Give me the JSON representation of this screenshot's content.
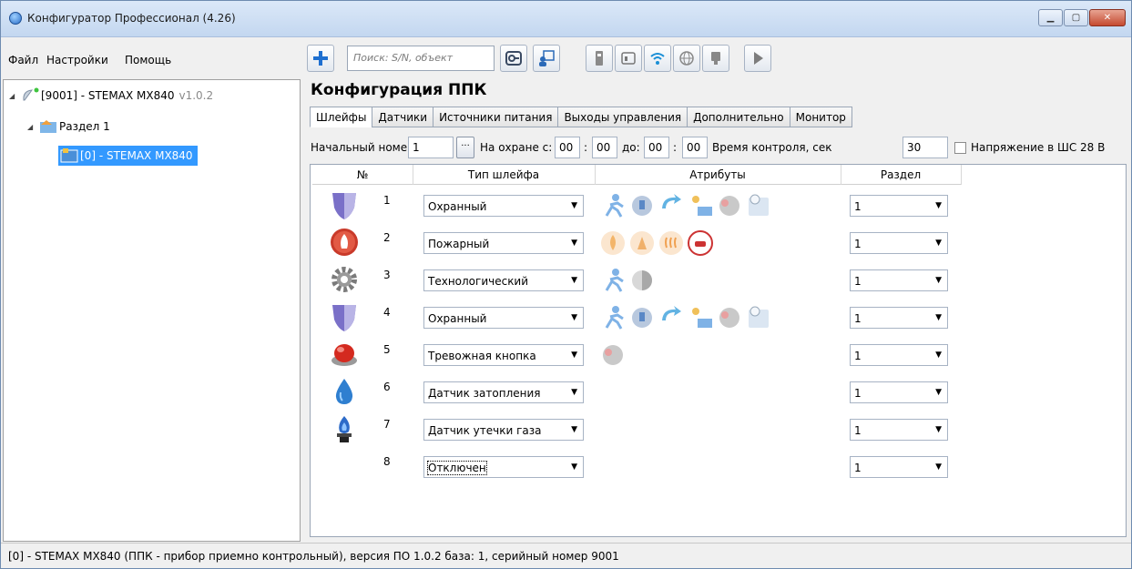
{
  "window": {
    "title": "Конфигуратор Профессионал (4.26)"
  },
  "menu": [
    "Файл",
    "Настройки",
    "Помощь"
  ],
  "toolbar": {
    "search_placeholder": "Поиск: S/N, объект"
  },
  "tree": {
    "root": {
      "label": "[9001] - STEMAX MX840",
      "version": "v1.0.2"
    },
    "partition": "Раздел 1",
    "device": "[0] - STEMAX MX840"
  },
  "main": {
    "title": "Конфигурация ППК",
    "tabs": [
      "Шлейфы",
      "Датчики",
      "Источники питания",
      "Выходы управления",
      "Дополнительно",
      "Монитор"
    ],
    "params": {
      "start_label": "Начальный номер",
      "start_value": "1",
      "dots": "...",
      "guard_label": "На охране с:",
      "from_h": "00",
      "from_m": "00",
      "to_label": "до:",
      "to_h": "00",
      "to_m": "00",
      "colon": ":",
      "control_label": "Время контроля, сек",
      "control_value": "30",
      "voltage_label": "Напряжение в ШС 28 В"
    },
    "grid": {
      "headers": [
        "№",
        "Тип шлейфа",
        "Атрибуты",
        "Раздел"
      ],
      "rows": [
        {
          "num": "1",
          "type": "Охранный",
          "icon": "shield-icon",
          "section": "1"
        },
        {
          "num": "2",
          "type": "Пожарный",
          "icon": "fire-icon",
          "section": "1"
        },
        {
          "num": "3",
          "type": "Технологический",
          "icon": "gear-icon",
          "section": "1"
        },
        {
          "num": "4",
          "type": "Охранный",
          "icon": "shield-icon",
          "section": "1"
        },
        {
          "num": "5",
          "type": "Тревожная кнопка",
          "icon": "alarm-button-icon",
          "section": "1"
        },
        {
          "num": "6",
          "type": "Датчик затопления",
          "icon": "water-drop-icon",
          "section": "1"
        },
        {
          "num": "7",
          "type": "Датчик утечки газа",
          "icon": "gas-flame-icon",
          "section": "1"
        },
        {
          "num": "8",
          "type": "Отключен",
          "icon": "",
          "section": "1"
        }
      ]
    }
  },
  "status": "[0] - STEMAX MX840 (ППК - прибор приемно контрольный), версия ПО 1.0.2 база: 1, серийный номер 9001"
}
